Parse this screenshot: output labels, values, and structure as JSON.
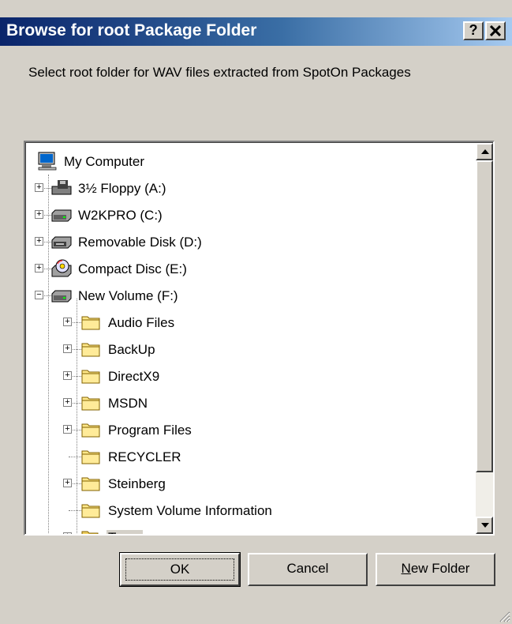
{
  "window": {
    "title": "Browse for root Package Folder",
    "help_label": "?",
    "close_label": "✕"
  },
  "instruction": "Select root folder for WAV files extracted from SpotOn Packages",
  "tree": {
    "root": {
      "label": "My Computer",
      "icon": "computer-icon"
    },
    "items": [
      {
        "label": "3½ Floppy (A:)",
        "icon": "floppy-drive-icon",
        "expander": "+"
      },
      {
        "label": "W2KPRO (C:)",
        "icon": "hard-drive-icon",
        "expander": "+"
      },
      {
        "label": "Removable Disk (D:)",
        "icon": "removable-disk-icon",
        "expander": "+"
      },
      {
        "label": "Compact Disc (E:)",
        "icon": "cd-drive-icon",
        "expander": "+"
      },
      {
        "label": "New Volume (F:)",
        "icon": "hard-drive-icon",
        "expander": "−"
      }
    ],
    "subitems": [
      {
        "label": "Audio Files",
        "icon": "folder-icon",
        "expander": "+"
      },
      {
        "label": "BackUp",
        "icon": "folder-icon",
        "expander": "+"
      },
      {
        "label": "DirectX9",
        "icon": "folder-icon",
        "expander": "+"
      },
      {
        "label": "MSDN",
        "icon": "folder-icon",
        "expander": "+"
      },
      {
        "label": "Program Files",
        "icon": "folder-icon",
        "expander": "+"
      },
      {
        "label": "RECYCLER",
        "icon": "folder-icon",
        "expander": ""
      },
      {
        "label": "Steinberg",
        "icon": "folder-icon",
        "expander": "+"
      },
      {
        "label": "System Volume Information",
        "icon": "folder-icon",
        "expander": ""
      },
      {
        "label": "Temp",
        "icon": "open-folder-icon",
        "expander": "+",
        "selected": true
      }
    ]
  },
  "buttons": {
    "ok": "OK",
    "cancel": "Cancel",
    "new_folder": "New Folder"
  }
}
